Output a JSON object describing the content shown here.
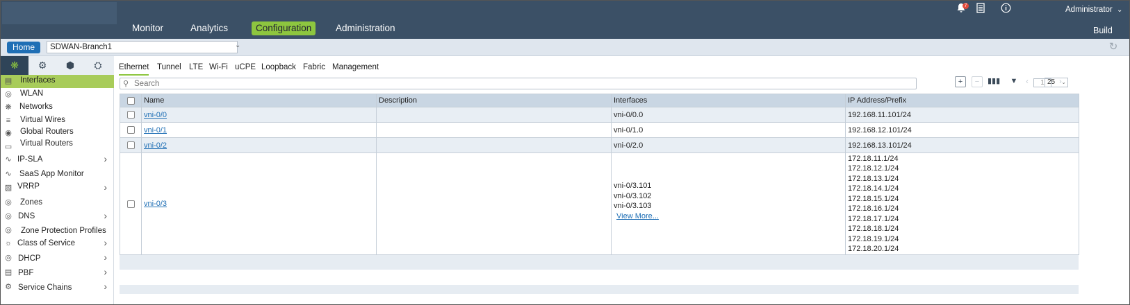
{
  "header": {
    "nav": [
      {
        "label": "Monitor"
      },
      {
        "label": "Analytics"
      },
      {
        "label": "Configuration",
        "active": true
      },
      {
        "label": "Administration"
      }
    ],
    "notification_count": "7",
    "user_label": "Administrator",
    "build_label": "Build"
  },
  "subbar": {
    "home_label": "Home",
    "appliance_value": "SDWAN-Branch1"
  },
  "sidebar": {
    "items": [
      {
        "label": "Interfaces",
        "icon": "interfaces-icon",
        "active": true
      },
      {
        "label": "WLAN",
        "icon": "wlan-icon"
      },
      {
        "label": "Networks",
        "icon": "networks-icon"
      },
      {
        "label": "Virtual Wires",
        "icon": "virtual-wires-icon"
      },
      {
        "label": "Global Routers",
        "icon": "global-routers-icon"
      },
      {
        "label": "Virtual Routers",
        "icon": "virtual-routers-icon"
      },
      {
        "label": "IP-SLA",
        "icon": "ip-sla-icon",
        "expandable": true
      },
      {
        "label": "SaaS App Monitor",
        "icon": "saas-app-monitor-icon"
      },
      {
        "label": "VRRP",
        "icon": "vrrp-icon",
        "expandable": true
      },
      {
        "label": "Zones",
        "icon": "zones-icon"
      },
      {
        "label": "DNS",
        "icon": "dns-icon",
        "expandable": true
      },
      {
        "label": "Zone Protection Profiles",
        "icon": "zone-protection-icon"
      },
      {
        "label": "Class of Service",
        "icon": "class-of-service-icon",
        "expandable": true
      },
      {
        "label": "DHCP",
        "icon": "dhcp-icon",
        "expandable": true
      },
      {
        "label": "PBF",
        "icon": "pbf-icon",
        "expandable": true
      },
      {
        "label": "Service Chains",
        "icon": "service-chains-icon",
        "expandable": true
      }
    ]
  },
  "tabs": [
    {
      "label": "Ethernet",
      "active": true
    },
    {
      "label": "Tunnel"
    },
    {
      "label": "LTE"
    },
    {
      "label": "Wi-Fi"
    },
    {
      "label": "uCPE"
    },
    {
      "label": "Loopback"
    },
    {
      "label": "Fabric"
    },
    {
      "label": "Management"
    }
  ],
  "search": {
    "placeholder": "Search"
  },
  "pagination": {
    "page": "1",
    "page_size": "25"
  },
  "table": {
    "columns": [
      "Name",
      "Description",
      "Interfaces",
      "IP Address/Prefix"
    ],
    "rows": [
      {
        "name": "vni-0/0",
        "description": "",
        "interfaces": [
          "vni-0/0.0"
        ],
        "ips": [
          "192.168.11.101/24"
        ]
      },
      {
        "name": "vni-0/1",
        "description": "",
        "interfaces": [
          "vni-0/1.0"
        ],
        "ips": [
          "192.168.12.101/24"
        ]
      },
      {
        "name": "vni-0/2",
        "description": "",
        "interfaces": [
          "vni-0/2.0"
        ],
        "ips": [
          "192.168.13.101/24"
        ]
      },
      {
        "name": "vni-0/3",
        "description": "",
        "interfaces": [
          "vni-0/3.101",
          "vni-0/3.102",
          "vni-0/3.103"
        ],
        "view_more": "View More...",
        "ips": [
          "172.18.11.1/24",
          "172.18.12.1/24",
          "172.18.13.1/24",
          "172.18.14.1/24",
          "172.18.15.1/24",
          "172.18.16.1/24",
          "172.18.17.1/24",
          "172.18.18.1/24",
          "172.18.19.1/24",
          "172.18.20.1/24"
        ]
      }
    ]
  }
}
